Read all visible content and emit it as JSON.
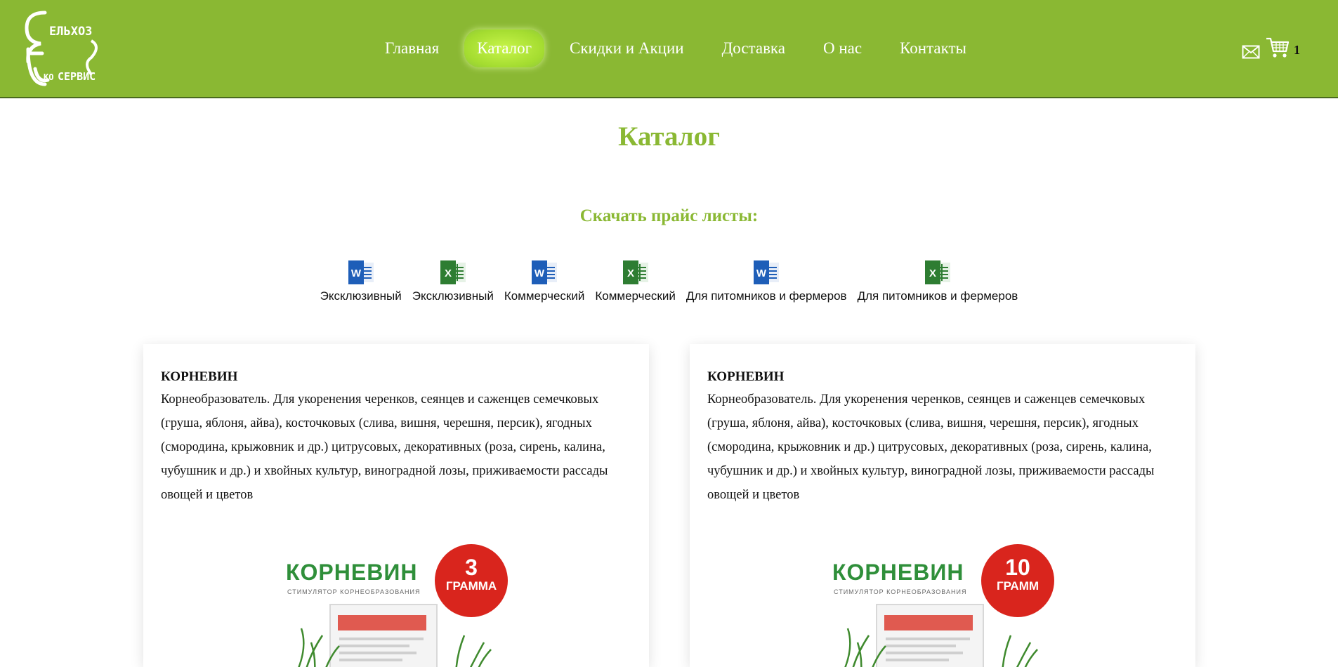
{
  "header": {
    "logo_text": "СельхозЭкоСервис",
    "nav": [
      {
        "label": "Главная",
        "active": false
      },
      {
        "label": "Каталог",
        "active": true
      },
      {
        "label": "Скидки и Акции",
        "active": false
      },
      {
        "label": "Доставка",
        "active": false
      },
      {
        "label": "О нас",
        "active": false
      },
      {
        "label": "Контакты",
        "active": false
      }
    ],
    "cart_count": "1"
  },
  "page": {
    "title": "Каталог",
    "downloads_title": "Скачать прайс листы:"
  },
  "downloads": [
    {
      "label": "Эксклюзивный",
      "type": "word-icon"
    },
    {
      "label": "Эксклюзивный",
      "type": "excel-icon"
    },
    {
      "label": "Коммерческий",
      "type": "word-icon"
    },
    {
      "label": "Коммерческий",
      "type": "excel-icon"
    },
    {
      "label": "Для питомников и фермеров",
      "type": "word-icon"
    },
    {
      "label": "Для питомников и фермеров",
      "type": "excel-icon"
    }
  ],
  "products": [
    {
      "name": "КОРНЕВИН",
      "description": "Корнеобразователь. Для укоренения черенков, сеянцев и саженцев семечковых (груша, яблоня, айва), косточковых (слива, вишня, черешня, персик), ягодных (смородина, крыжовник и др.) цитрусовых, декоративных (роза, сирень, калина, чубушник и др.) и хвойных культур, виноградной лозы, приживаемости рассады овощей и цветов",
      "image_brand": "КОРНЕВИН",
      "image_sub": "СТИМУЛЯТОР КОРНЕОБРАЗОВАНИЯ",
      "badge_number": "3",
      "badge_unit": "ГРАММА"
    },
    {
      "name": "КОРНЕВИН",
      "description": "Корнеобразователь. Для укоренения черенков, сеянцев и саженцев семечковых (груша, яблоня, айва), косточковых (слива, вишня, черешня, персик), ягодных (смородина, крыжовник и др.) цитрусовых, декоративных (роза, сирень, калина, чубушник и др.) и хвойных культур, виноградной лозы, приживаемости рассады овощей и цветов",
      "image_brand": "КОРНЕВИН",
      "image_sub": "СТИМУЛЯТОР КОРНЕОБРАЗОВАНИЯ",
      "badge_number": "10",
      "badge_unit": "ГРАММ"
    }
  ],
  "colors": {
    "header_bg": "#8ab833",
    "accent": "#8ab833",
    "active_nav": "#b8ec3c",
    "word_blue": "#1e5eb8",
    "excel_green": "#2e7d32",
    "badge_red": "#d9251d"
  }
}
